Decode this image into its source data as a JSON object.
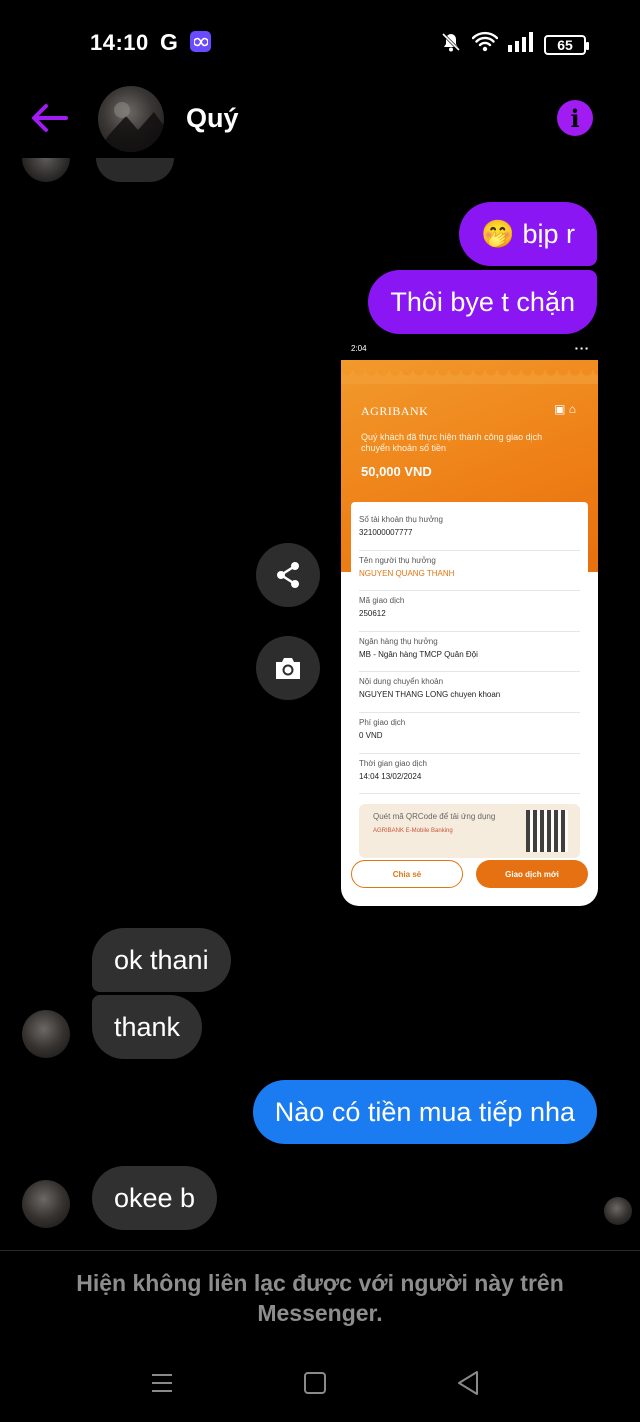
{
  "status_bar": {
    "time": "14:10",
    "g_label": "G",
    "battery": "65",
    "icons": [
      "mute-icon",
      "wifi-icon",
      "signal-icon",
      "battery-icon"
    ]
  },
  "header": {
    "contact_name": "Quý",
    "accent_color": "#a11bf3"
  },
  "messages": {
    "out1": "🤭 bịp r",
    "out2": "Thôi bye t chặn",
    "in1": "ok thani",
    "in2": "thank",
    "out3": "Nào có tiền mua tiếp nha",
    "in3": "okee b"
  },
  "colors": {
    "outgoing_purple": "#8a16f3",
    "outgoing_blue": "#1a7cf0",
    "incoming_gray": "#303030"
  },
  "receipt": {
    "status_time": "2:04",
    "bank_name": "AGRIBANK",
    "message": "Quý khách đã thực hiện thành công giao dịch chuyển khoản số tiền",
    "amount": "50,000 VND",
    "rows": [
      {
        "label": "Số tài khoản thụ hưởng",
        "value": "321000007777"
      },
      {
        "label": "Tên người thụ hưởng",
        "value": "NGUYEN QUANG THANH"
      },
      {
        "label": "Mã giao dịch",
        "value": "250612"
      },
      {
        "label": "Ngân hàng thụ hưởng",
        "value": "MB - Ngân hàng TMCP Quân Đội"
      },
      {
        "label": "Nội dung chuyển khoản",
        "value": "NGUYEN THANG LONG chuyen khoan"
      },
      {
        "label": "Phí giao dịch",
        "value": "0 VND"
      },
      {
        "label": "Thời gian giao dịch",
        "value": "14:04 13/02/2024"
      }
    ],
    "qr_text": "Quét mã QRCode để tải ứng dụng",
    "qr_sub": "AGRIBANK E-Mobile Banking",
    "share_button": "Chia sẻ",
    "new_button": "Giao dịch mới"
  },
  "footer": {
    "notice": "Hiện không liên lạc được với người này trên Messenger."
  }
}
